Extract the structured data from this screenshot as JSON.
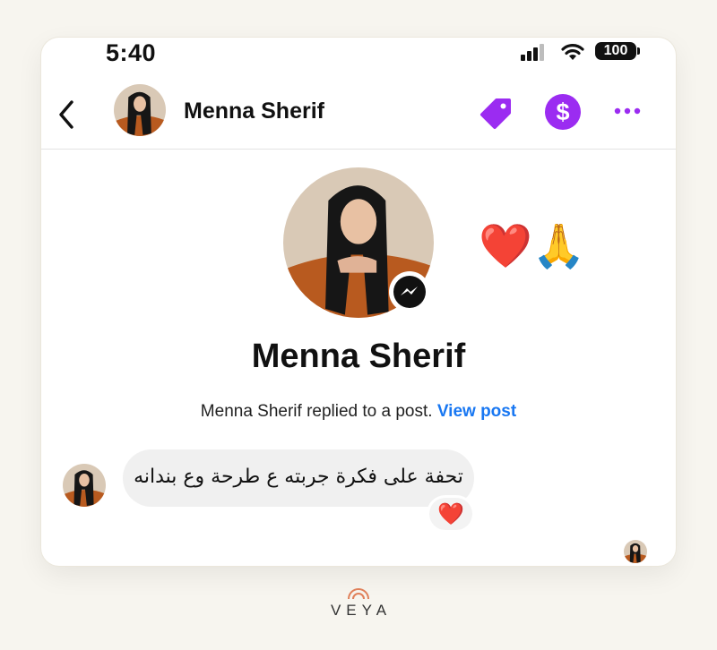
{
  "status_bar": {
    "time": "5:40",
    "battery": "100"
  },
  "header": {
    "back_icon": "chevron-left-icon",
    "name": "Menna Sherif",
    "actions": [
      "tag-icon",
      "dollar-icon",
      "more-horizontal-icon"
    ]
  },
  "profile": {
    "name": "Menna Sherif",
    "badge_icon": "messenger-icon",
    "reactions": "❤️🙏",
    "reply_text": "Menna Sherif replied to a post.",
    "view_post": "View post"
  },
  "message": {
    "text": "تحفة على فكرة جربته ع طرحة وع بندانه",
    "reaction": "❤️"
  },
  "colors": {
    "accent_purple": "#9b2cf1",
    "link_blue": "#1877f2",
    "bubble_gray": "#f0f0f0",
    "heart_red": "#e0202a"
  },
  "brand": {
    "name": "VEYA"
  }
}
